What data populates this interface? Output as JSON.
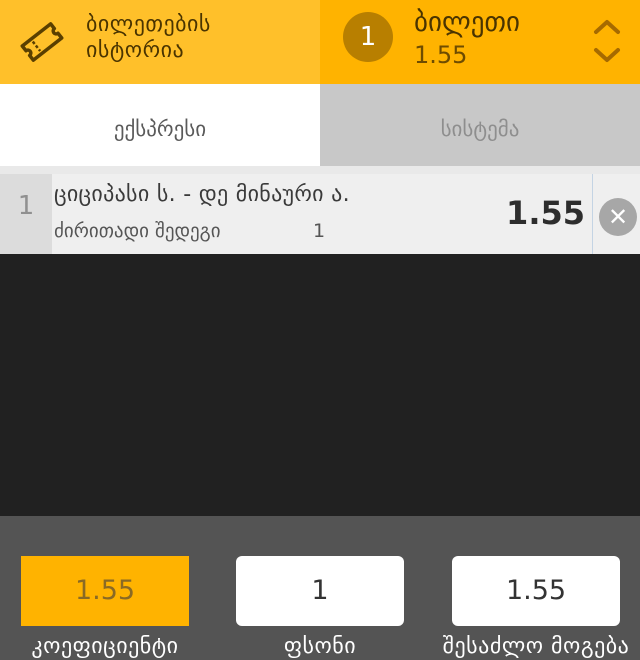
{
  "header": {
    "history_label_line1": "ბილეთების",
    "history_label_line2": "ისტორია",
    "ticket_count": "1",
    "ticket_label": "ბილეთი",
    "ticket_odds": "1.55"
  },
  "tabs": [
    {
      "label": "ექსპრესი",
      "active": true
    },
    {
      "label": "სისტემა",
      "active": false
    }
  ],
  "bets": [
    {
      "index": "1",
      "event": "ციციპასი ს. - დე მინაური ა.",
      "market": "ძირითადი შედეგი",
      "pick": "1",
      "odds": "1.55"
    }
  ],
  "footer": {
    "coefficient_value": "1.55",
    "coefficient_label": "კოეფიციენტი",
    "stake_value": "1",
    "stake_label": "ფსონი",
    "possible_win_value": "1.55",
    "possible_win_label": "შესაძლო მოგება"
  },
  "colors": {
    "accent": "#ffb300",
    "accent_light": "#ffc02a",
    "dark_bg": "#212121",
    "footer_bg": "#545454"
  },
  "icons": [
    "ticket-icon",
    "remove-icon",
    "expand-arrows-icon"
  ]
}
